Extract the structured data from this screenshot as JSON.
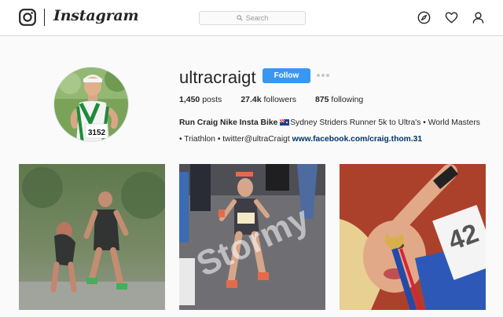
{
  "header": {
    "logo_icon": "instagram-camera-icon",
    "wordmark": "Instagram",
    "search_placeholder": "Search",
    "nav_icons": [
      "compass-icon",
      "heart-icon",
      "person-icon"
    ]
  },
  "profile": {
    "username": "ultracraigt",
    "follow_label": "Follow",
    "more_icon": "ellipsis-icon",
    "stats": {
      "posts_count": "1,450",
      "posts_label": "posts",
      "followers_count": "27.4k",
      "followers_label": "followers",
      "following_count": "875",
      "following_label": "following"
    },
    "bio": {
      "name": "Run Craig Nike Insta Bike",
      "line1_rest": "Sydney Striders Runner 5k to Ultra's • World Masters",
      "line2": "• Triathlon • twitter@ultraCraigt",
      "link": "www.facebook.com/craig.thom.31"
    },
    "avatar_bib": "3152"
  },
  "posts": [
    {
      "alt": "two triathletes running in rain"
    },
    {
      "alt": "woman runner in marathon",
      "watermark": "Stormy"
    },
    {
      "alt": "woman biting medal"
    }
  ],
  "colors": {
    "accent": "#3897f0",
    "link": "#003569",
    "text": "#262626",
    "background": "#fafafa"
  }
}
